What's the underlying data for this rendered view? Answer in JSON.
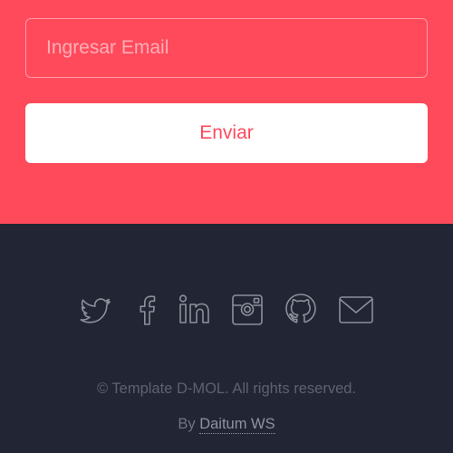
{
  "form": {
    "email_placeholder": "Ingresar Email",
    "email_value": "",
    "submit_label": "Enviar"
  },
  "footer": {
    "social_icons": [
      "twitter-icon",
      "facebook-icon",
      "linkedin-icon",
      "instagram-icon",
      "github-icon",
      "mail-icon"
    ],
    "copyright": "© Template D-MOL. All rights reserved.",
    "by_prefix": "By",
    "author": "Daitum WS"
  },
  "colors": {
    "accent": "#ff4a5c",
    "footer_bg": "#222533",
    "icon": "#8d909b"
  }
}
